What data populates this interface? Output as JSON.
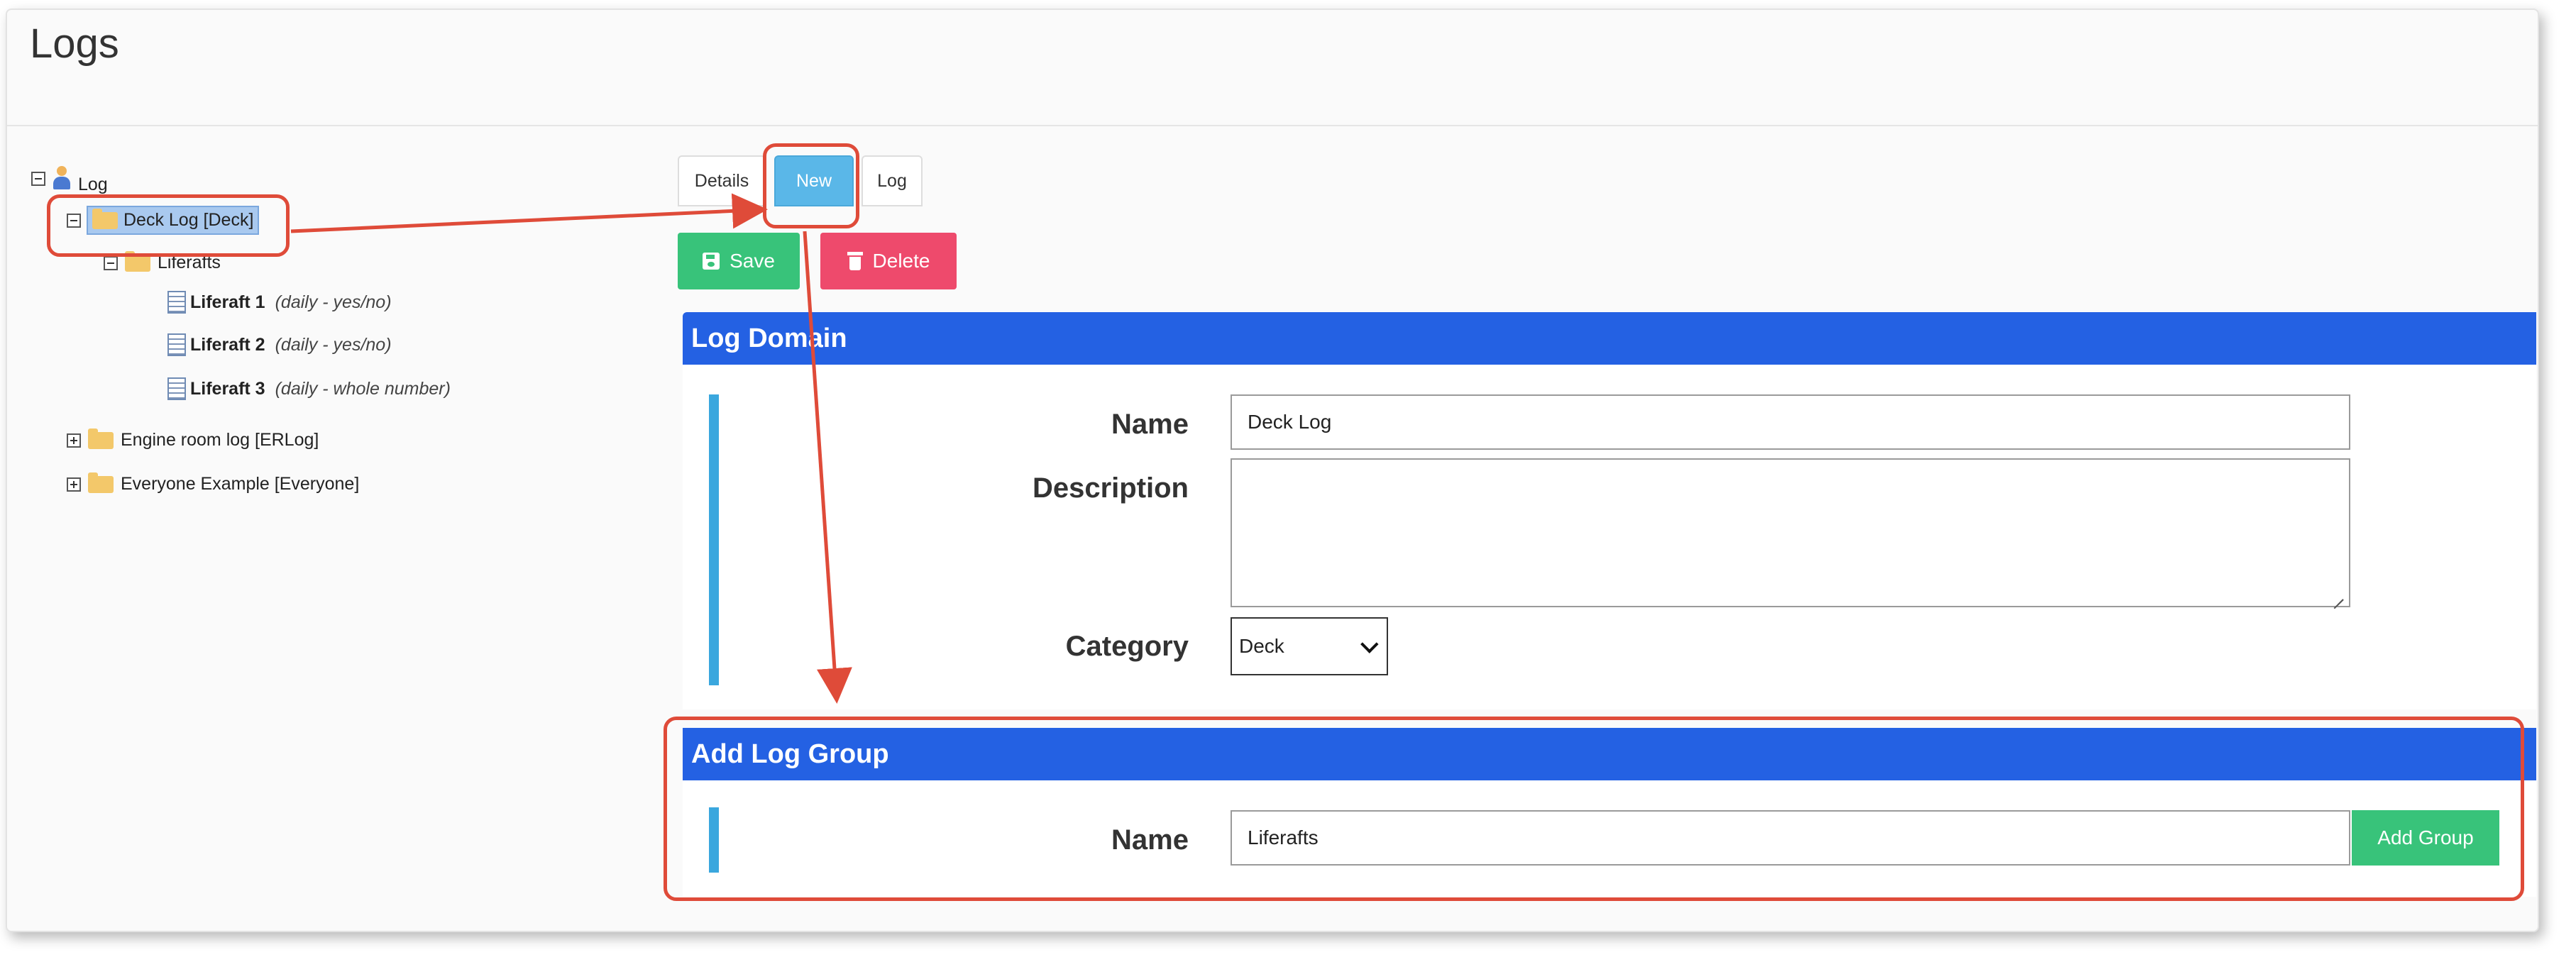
{
  "page": {
    "title": "Logs"
  },
  "tree": {
    "root": {
      "label": "Log"
    },
    "deck_log": {
      "label": "Deck Log [Deck]"
    },
    "group": {
      "label": "Liferafts"
    },
    "items": [
      {
        "name": "Liferaft 1",
        "meta": "(daily - yes/no)"
      },
      {
        "name": "Liferaft 2",
        "meta": "(daily - yes/no)"
      },
      {
        "name": "Liferaft 3",
        "meta": "(daily - whole number)"
      }
    ],
    "collapsed": [
      {
        "label": "Engine room log [ERLog]"
      },
      {
        "label": "Everyone Example [Everyone]"
      }
    ]
  },
  "tabs": [
    {
      "label": "Details",
      "active": false
    },
    {
      "label": "New",
      "active": true
    },
    {
      "label": "Log",
      "active": false
    }
  ],
  "toolbar": {
    "save_label": "Save",
    "delete_label": "Delete"
  },
  "log_domain": {
    "header": "Log Domain",
    "name_label": "Name",
    "name_value": "Deck Log",
    "description_label": "Description",
    "description_value": "",
    "category_label": "Category",
    "category_value": "Deck"
  },
  "add_log_group": {
    "header": "Add Log Group",
    "name_label": "Name",
    "name_value": "Liferafts",
    "button_label": "Add Group"
  },
  "colors": {
    "panel_header": "#2461e3",
    "accent": "#3aa7de",
    "save": "#38c37a",
    "delete": "#ee4a6c",
    "active_tab": "#5ab7e8",
    "annotation": "#df4b39"
  }
}
